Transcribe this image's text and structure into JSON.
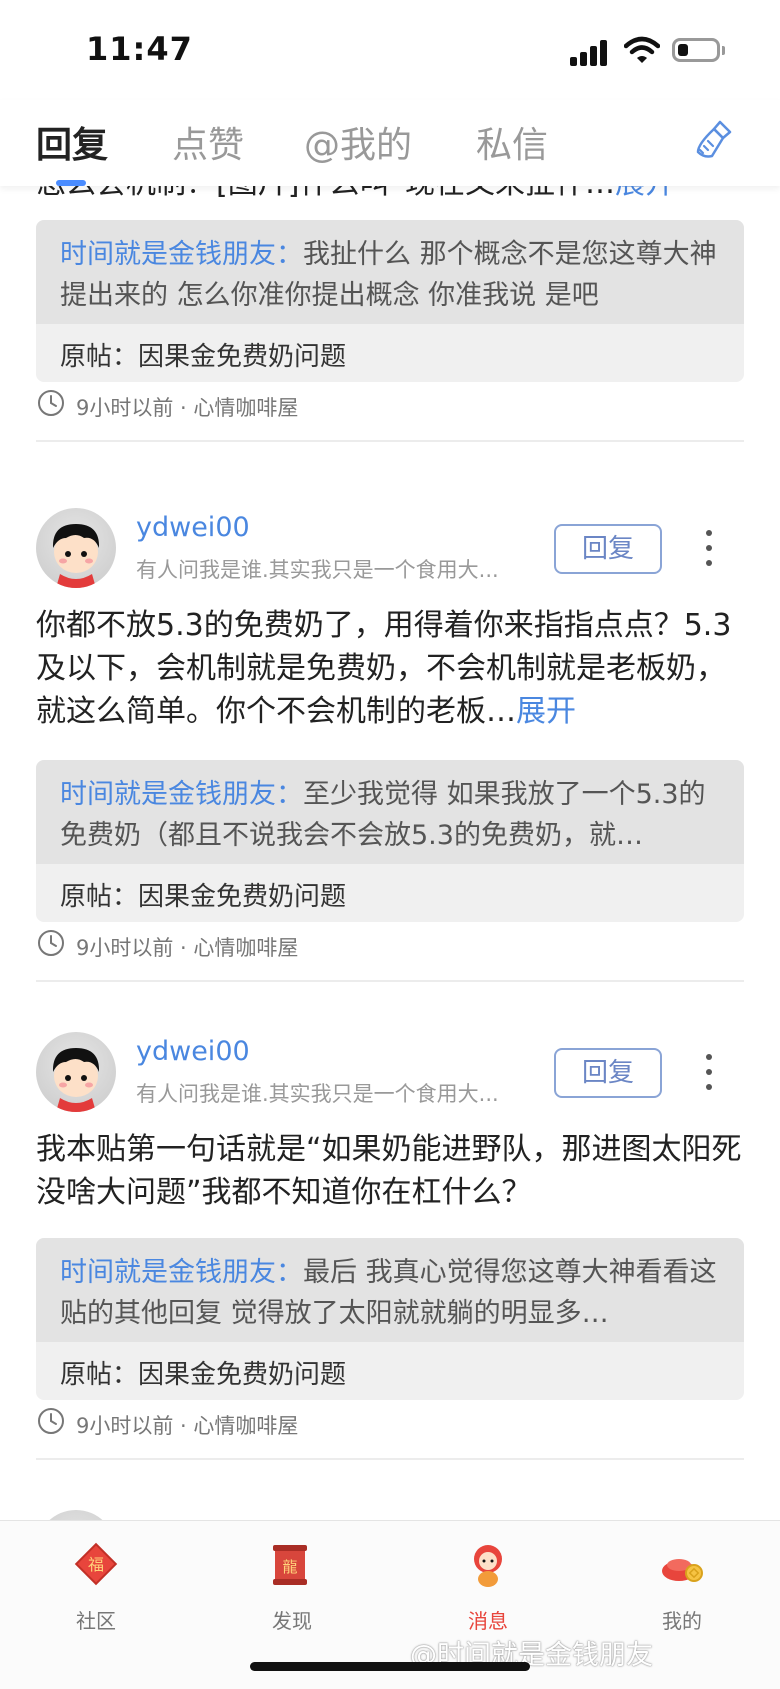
{
  "status_bar": {
    "time": "11:47"
  },
  "tabs": [
    {
      "label": "回复",
      "active": true
    },
    {
      "label": "点赞",
      "active": false
    },
    {
      "label": "@我的",
      "active": false
    },
    {
      "label": "私信",
      "active": false
    }
  ],
  "feed": {
    "partial_item": {
      "body_text": "怎么会机制？[图片]什么叫“现在又来扯什…",
      "expand_label": "展开",
      "quote_author": "时间就是金钱朋友：",
      "quote_text": "我扯什么 那个概念不是您这尊大神提出来的 怎么你准你提出概念 你准我说 是吧",
      "source_post": "原帖：因果金免费奶问题",
      "meta": "9小时以前 · 心情咖啡屋"
    },
    "items": [
      {
        "username": "ydwei00",
        "signature": "有人问我是谁.其实我只是一个食用大...",
        "reply_label": "回复",
        "body_text": "你都不放5.3的免费奶了，用得着你来指指点点？5.3及以下，会机制就是免费奶，不会机制就是老板奶，就这么简单。你个不会机制的老板…",
        "expand_label": "展开",
        "quote_author": "时间就是金钱朋友：",
        "quote_text": "至少我觉得 如果我放了一个5.3的免费奶（都且不说我会不会放5.3的免费奶，就…",
        "source_post": "原帖：因果金免费奶问题",
        "meta": "9小时以前 · 心情咖啡屋"
      },
      {
        "username": "ydwei00",
        "signature": "有人问我是谁.其实我只是一个食用大...",
        "reply_label": "回复",
        "body_text": "我本贴第一句话就是“如果奶能进野队，那进图太阳死没啥大问题”我都不知道你在杠什么？",
        "expand_label": "",
        "quote_author": "时间就是金钱朋友：",
        "quote_text": "最后 我真心觉得您这尊大神看看这贴的其他回复 觉得放了太阳就就躺的明显多…",
        "source_post": "原帖：因果金免费奶问题",
        "meta": "9小时以前 · 心情咖啡屋"
      }
    ]
  },
  "bottom_nav": [
    {
      "label": "社区",
      "icon": "community-icon",
      "active": false
    },
    {
      "label": "发现",
      "icon": "discover-icon",
      "active": false
    },
    {
      "label": "消息",
      "icon": "message-icon",
      "active": true
    },
    {
      "label": "我的",
      "icon": "profile-icon",
      "active": false
    }
  ],
  "watermark": "@时间就是金钱朋友",
  "colors": {
    "accent_blue": "#4a87e0",
    "active_red": "#e8453c"
  }
}
